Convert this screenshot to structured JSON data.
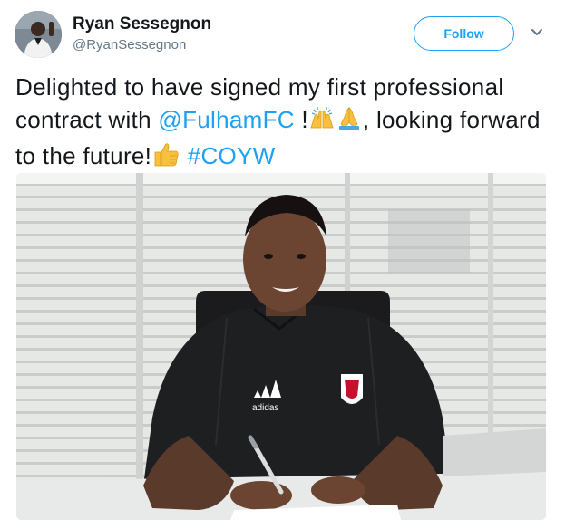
{
  "user": {
    "display_name": "Ryan Sessegnon",
    "handle": "@RyanSessegnon"
  },
  "actions": {
    "follow_label": "Follow"
  },
  "tweet": {
    "part1": "Delighted to have signed my first professional contract with ",
    "mention": "@FulhamFC",
    "part2": " !",
    "emoji1": "raising-hands-icon",
    "emoji2": "folded-hands-icon",
    "part3": ", looking forward to the future!",
    "emoji3": "thumbs-up-icon",
    "part4": " ",
    "hashtag": "#COYW"
  },
  "photo": {
    "shirt_brand": "adidas"
  },
  "colors": {
    "accent": "#1da1f2",
    "text": "#14171a",
    "muted": "#657786"
  }
}
